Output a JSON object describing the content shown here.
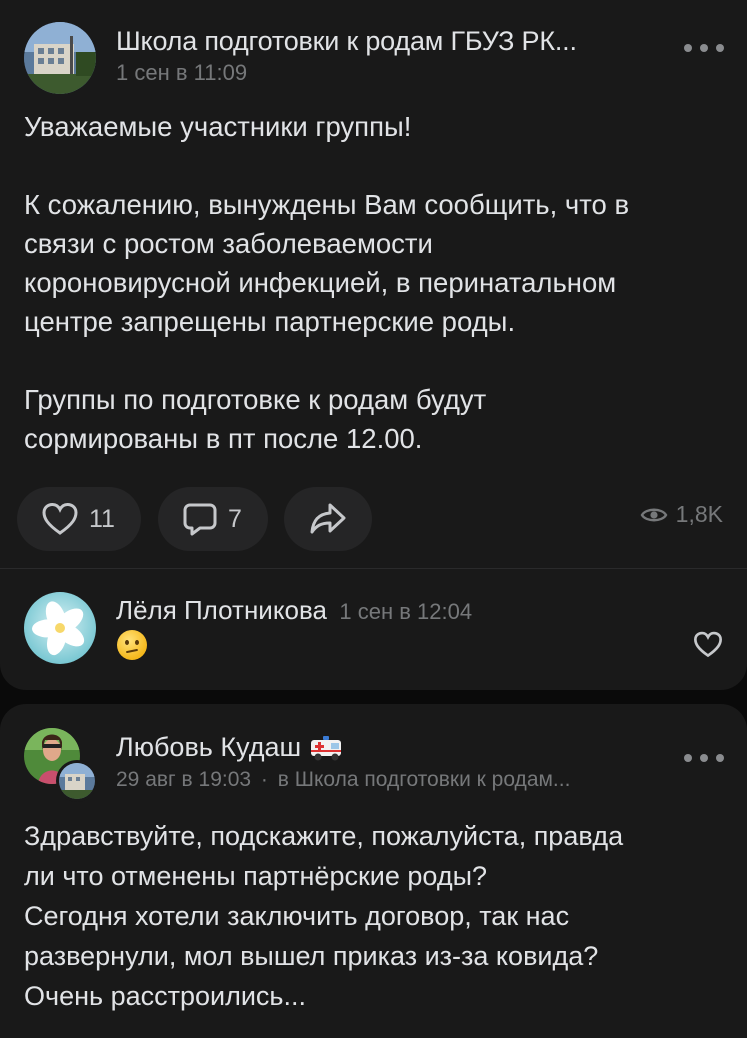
{
  "post": {
    "author": "Школа подготовки к родам ГБУЗ РК...",
    "timestamp": "1 сен в 11:09",
    "greeting": "Уважаемые участники группы!",
    "paragraph1_lines": [
      "К сожалению, вынуждены Вам сообщить, что в",
      "связи с ростом заболеваемости",
      "короновирусной инфекцией, в перинатальном",
      "центре запрещены партнерские роды."
    ],
    "paragraph2_lines": [
      "Группы по подготовке к родам будут",
      "сормированы в пт после 12.00."
    ],
    "likes": "11",
    "comments": "7",
    "views": "1,8K",
    "icons": {
      "like": "heart-icon",
      "comment": "comment-icon",
      "share": "share-icon",
      "views": "eye-icon",
      "more": "more-icon"
    }
  },
  "comment": {
    "author": "Лёля Плотникова",
    "timestamp": "1 сен в 12:04",
    "emoji": "confused-face-emoji"
  },
  "post2": {
    "author": "Любовь Кудаш",
    "badge": "ambulance-emoji",
    "timestamp": "29 авг в 19:03",
    "separator": "·",
    "source": "в Школа подготовки к родам...",
    "lines": [
      "Здравствуйте, подскажите, пожалуйста, правда",
      "ли что отменены партнёрские роды?",
      "Сегодня хотели заключить договор, так нас",
      "развернули, мол вышел приказ из-за ковида?",
      "Очень расстроились..."
    ]
  },
  "colors": {
    "background": "#0a0a0a",
    "card": "#191919",
    "text": "#e1e3e6",
    "secondary": "#76787a",
    "pill": "#252526"
  }
}
